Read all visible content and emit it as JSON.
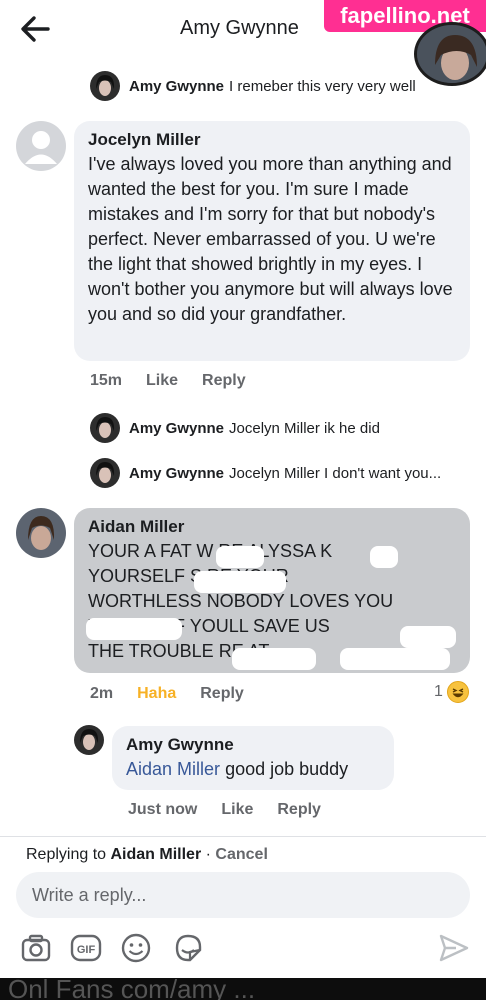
{
  "header": {
    "title": "Amy Gwynne",
    "watermark": "fapellino.net"
  },
  "thread": {
    "reply_1": {
      "name": "Amy Gwynne",
      "text": "I remeber this very very well"
    },
    "comment_1": {
      "name": "Jocelyn Miller",
      "text": "I've always loved you more than anything and wanted the best for you. I'm sure I made mistakes and I'm sorry for that but nobody's perfect. Never embarrassed of you. U we're the light that showed brightly in my eyes. I won't bother you anymore but will always love you and so did your grandfather.",
      "time": "15m",
      "like": "Like",
      "reply": "Reply"
    },
    "reply_2": {
      "name": "Amy Gwynne",
      "text": "Jocelyn Miller ik he did"
    },
    "reply_3": {
      "name": "Amy Gwynne",
      "text": "Jocelyn Miller I don't want you..."
    },
    "comment_2": {
      "name": "Aidan Miller",
      "lines": [
        "YOUR A FAT W    RE ALYSSA K",
        "YOURSELF S          RE YOUR",
        "WORTHLESS NOBODY LOVES YOU",
        "        YOURSELF YOULL SAVE US",
        "THE TROUBLE RE       AT"
      ],
      "time": "2m",
      "reaction_label": "Haha",
      "reply": "Reply",
      "reaction_count": "1"
    },
    "comment_3": {
      "name": "Amy Gwynne",
      "mention": "Aidan Miller",
      "text": "good job buddy",
      "time": "Just now",
      "like": "Like",
      "reply": "Reply"
    }
  },
  "composer": {
    "replying_prefix": "Replying to",
    "replying_to": "Aidan Miller",
    "separator": "·",
    "cancel": "Cancel",
    "placeholder": "Write a reply...",
    "icons": [
      "camera-icon",
      "gif-icon",
      "emoji-icon",
      "sticker-icon",
      "send-icon"
    ]
  },
  "colors": {
    "bubble": "#eff1f5",
    "bubble_dark": "#c9cbce",
    "link": "#385898",
    "haha": "#f7b125",
    "watermark": "#ff2f92"
  },
  "bottom_strip": "Onl Fans com/amy ..."
}
